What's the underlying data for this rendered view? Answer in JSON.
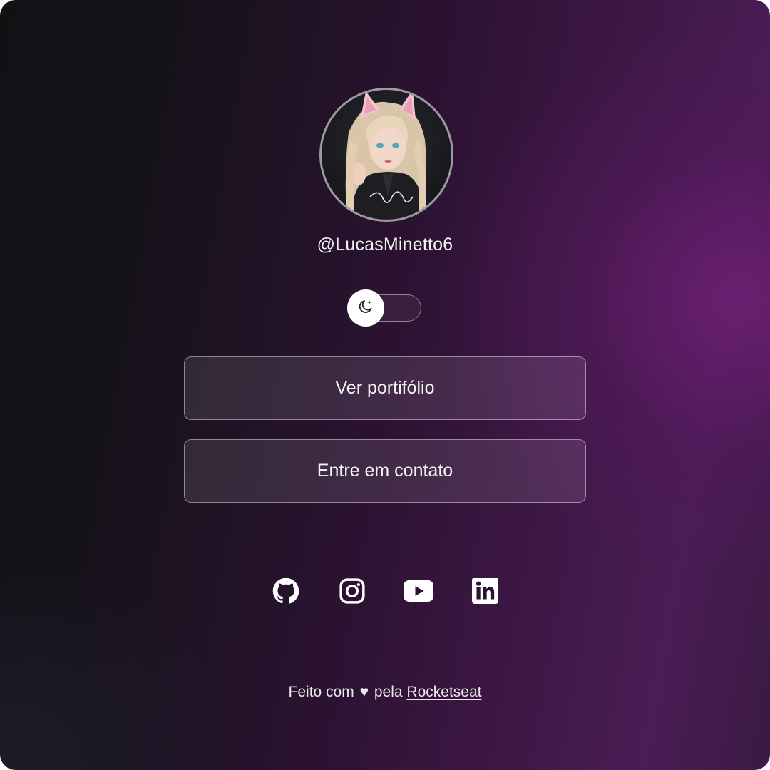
{
  "profile": {
    "username": "@LucasMinetto6",
    "avatar_alt": ""
  },
  "theme_switch": {
    "icon": "moon-stars-icon",
    "state": "dark"
  },
  "links": [
    {
      "label": "Ver portifólio"
    },
    {
      "label": "Entre em contato"
    }
  ],
  "socials": [
    {
      "icon": "github-icon"
    },
    {
      "icon": "instagram-icon"
    },
    {
      "icon": "youtube-icon"
    },
    {
      "icon": "linkedin-icon"
    }
  ],
  "footer": {
    "prefix": "Feito com",
    "heart": "♥",
    "middle": "pela",
    "link_text": "Rocketseat"
  },
  "colors": {
    "background_dark": "#111114",
    "background_purple": "#5a1c64",
    "button_border": "#ffffff73",
    "text": "#f2f2f2"
  }
}
